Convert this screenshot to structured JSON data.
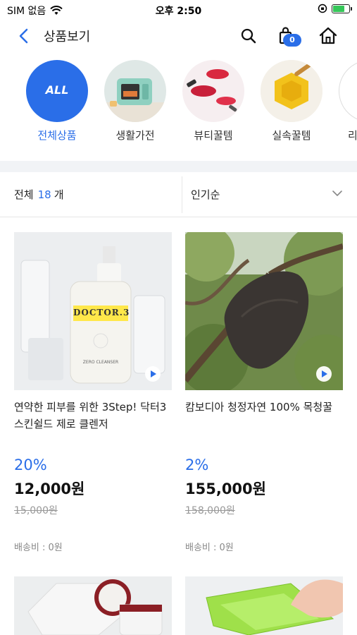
{
  "status_bar": {
    "carrier": "SIM 없음",
    "time": "오후 2:50",
    "battery_level": 0.8
  },
  "nav": {
    "title": "상품보기",
    "cart_count": "0",
    "icons": [
      "back-chevron-icon",
      "search-icon",
      "shopping-bag-icon",
      "home-icon"
    ]
  },
  "categories": [
    {
      "label": "전체상품",
      "badge": "ALL",
      "active": true
    },
    {
      "label": "생활가전",
      "active": false
    },
    {
      "label": "뷰티꿀템",
      "active": false
    },
    {
      "label": "실속꿀템",
      "active": false
    },
    {
      "label": "리",
      "active": false
    }
  ],
  "filter": {
    "count_prefix": "전체",
    "count_value": "18",
    "count_unit": "개",
    "sort_label": "인기순"
  },
  "products": [
    {
      "name": "연약한 피부를 위한 3Step! 닥터3 스킨쉴드 제로 클렌저",
      "image_text": "DOCTOR.3",
      "image_subtext": "ZERO CLEANSER",
      "discount": "20%",
      "price": "12,000원",
      "original_price": "15,000원",
      "shipping": "배송비 : 0원"
    },
    {
      "name": "캄보디아 청정자연 100% 목청꿀",
      "discount": "2%",
      "price": "155,000원",
      "original_price": "158,000원",
      "shipping": "배송비 : 0원"
    }
  ],
  "colors": {
    "accent": "#2a6ee8",
    "band": "#f1f3f6"
  }
}
